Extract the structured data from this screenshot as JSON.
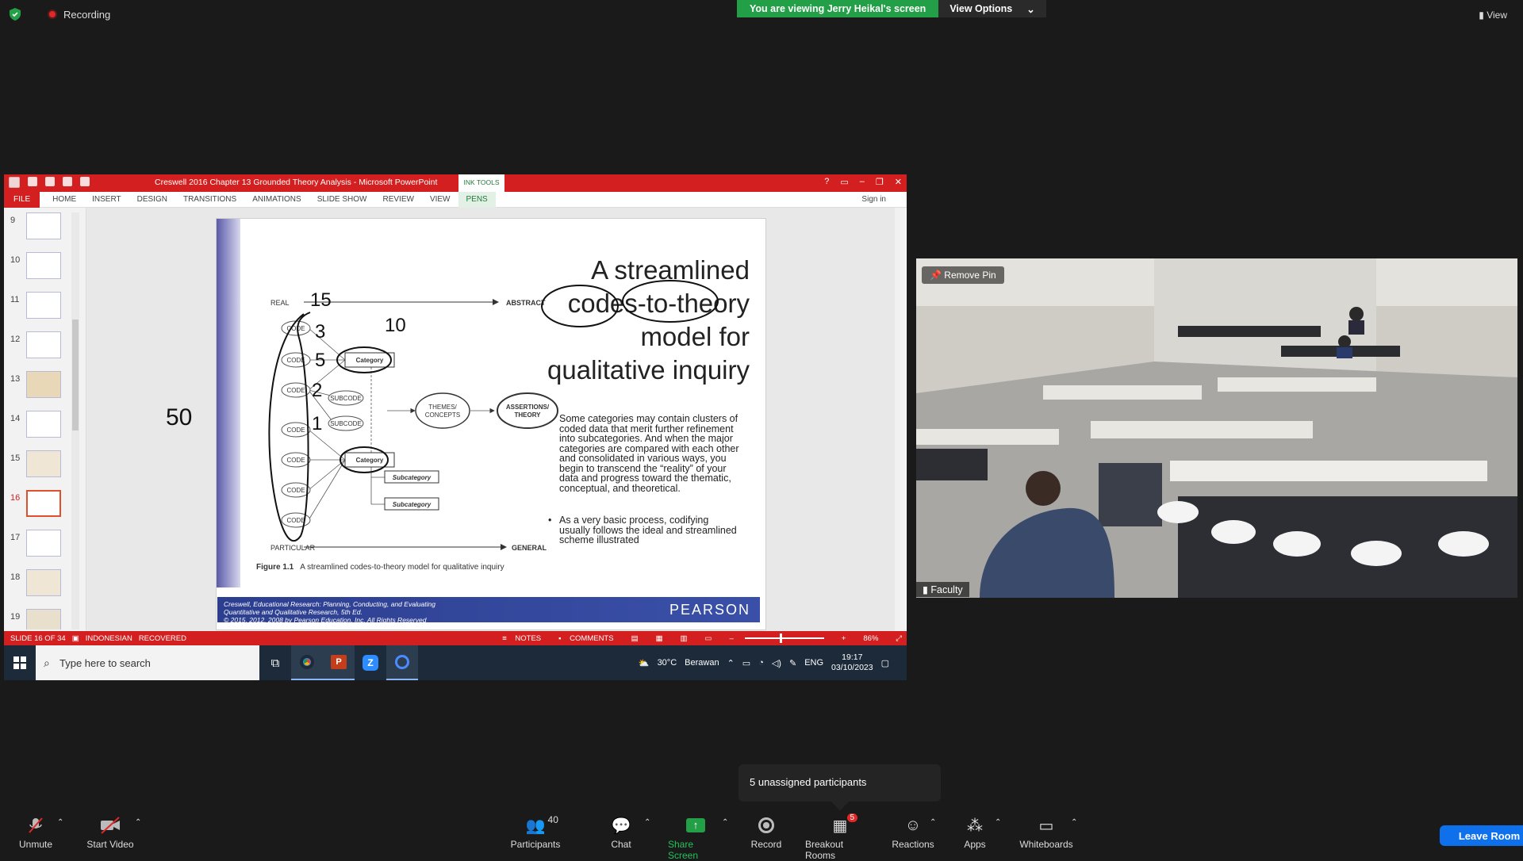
{
  "zoom_top": {
    "recording_label": "Recording",
    "viewing_banner": "You are viewing Jerry Heikal's screen",
    "view_options_label": "View Options",
    "view_label": "View"
  },
  "powerpoint": {
    "doc_title": "Creswell 2016 Chapter 13 Grounded Theory Analysis  -  Microsoft PowerPoint",
    "context_tab": "INK TOOLS",
    "tabs": [
      "FILE",
      "HOME",
      "INSERT",
      "DESIGN",
      "TRANSITIONS",
      "ANIMATIONS",
      "SLIDE SHOW",
      "REVIEW",
      "VIEW",
      "PENS"
    ],
    "sign_in": "Sign in",
    "thumb_numbers": [
      "9",
      "10",
      "11",
      "12",
      "13",
      "14",
      "15",
      "16",
      "17",
      "18",
      "19"
    ],
    "selected_slide": "16",
    "status": {
      "slide": "SLIDE 16 OF 34",
      "language": "INDONESIAN",
      "recovered": "RECOVERED",
      "notes": "NOTES",
      "comments": "COMMENTS",
      "zoom": "86%"
    }
  },
  "slide": {
    "title_lines": [
      "A streamlined",
      "codes-to-theory",
      "model for",
      "qualitative inquiry"
    ],
    "bullet1": "Some categories may contain clusters of coded data that merit further refinement into subcategories. And when the major categories are compared with each other and consolidated in various ways, you begin to transcend the “reality” of your data and progress toward the thematic, conceptual, and theoretical.",
    "bullet2": "As a very basic process, codifying usually follows the ideal and streamlined scheme illustrated",
    "diagram": {
      "real": "REAL",
      "abstract": "ABSTRACT",
      "particular": "PARTICULAR",
      "general": "GENERAL",
      "code": "CODE",
      "category": "Category",
      "subcode": "SUBCODE",
      "subcategory": "Subcategory",
      "themes": [
        "THEMES/",
        "CONCEPTS"
      ],
      "assertions": [
        "ASSERTIONS/",
        "THEORY"
      ]
    },
    "annotations": [
      "15",
      "3",
      "5",
      "2",
      "1",
      "10",
      "50"
    ],
    "figure_label": "Figure 1.1",
    "figure_caption": "A streamlined codes-to-theory model for qualitative inquiry",
    "footer_cite_1": "Creswell, Educational Research: Planning, Conducting, and Evaluating",
    "footer_cite_2": "Quantitative and Qualitative Research, 5th Ed.",
    "footer_cite_3": "© 2015, 2012, 2008 by Pearson Education, Inc. All Rights Reserved",
    "footer_brand": "PEARSON"
  },
  "windows_taskbar": {
    "search_placeholder": "Type here to search",
    "weather_temp": "30°C",
    "weather_text": "Berawan",
    "lang": "ENG",
    "time": "19:17",
    "date": "03/10/2023"
  },
  "video": {
    "remove_pin": "Remove Pin",
    "participant_name": "Faculty"
  },
  "popup": {
    "unassigned": "5 unassigned participants"
  },
  "toolbar": {
    "unmute": "Unmute",
    "start_video": "Start Video",
    "participants": "Participants",
    "participants_count": "40",
    "chat": "Chat",
    "share_screen": "Share Screen",
    "record": "Record",
    "breakout_rooms": "Breakout Rooms",
    "breakout_badge": "5",
    "reactions": "Reactions",
    "apps": "Apps",
    "whiteboards": "Whiteboards",
    "leave": "Leave Room"
  },
  "colors": {
    "zoom_green": "#23a047",
    "ppt_red": "#d31f1f",
    "leave_blue": "#0e71eb"
  }
}
